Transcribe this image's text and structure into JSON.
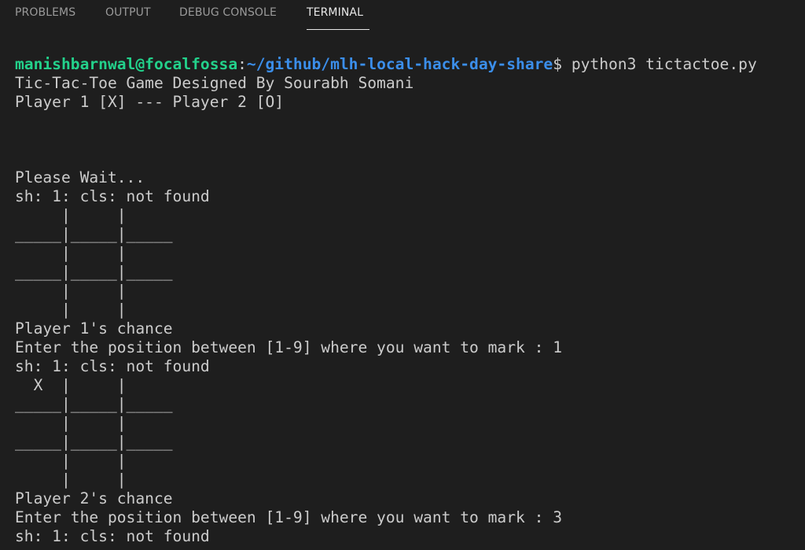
{
  "tabs": [
    {
      "label": "PROBLEMS",
      "active": false
    },
    {
      "label": "OUTPUT",
      "active": false
    },
    {
      "label": "DEBUG CONSOLE",
      "active": false
    },
    {
      "label": "TERMINAL",
      "active": true
    }
  ],
  "colors": {
    "background": "#1e1e1e",
    "text": "#cccccc",
    "prompt_user": "#23d18b",
    "prompt_path": "#3b8eea",
    "tab_inactive": "#9a9a9a",
    "tab_active": "#e7e7e7"
  },
  "prompt": {
    "user_host": "manishbarnwal@focalfossa",
    "separator": ":",
    "path": "~/github/mlh-local-hack-day-share",
    "symbol": "$ ",
    "command": "python3 tictactoe.py"
  },
  "output_lines": [
    "Tic-Tac-Toe Game Designed By Sourabh Somani",
    "Player 1 [X] --- Player 2 [O]",
    "",
    "",
    "",
    "Please Wait...",
    "sh: 1: cls: not found",
    "     |     |",
    "_____|_____|_____",
    "     |     |",
    "_____|_____|_____",
    "     |     |",
    "     |     |",
    "Player 1's chance",
    "Enter the position between [1-9] where you want to mark : 1",
    "sh: 1: cls: not found",
    "  X  |     |",
    "_____|_____|_____",
    "     |     |",
    "_____|_____|_____",
    "     |     |",
    "     |     |",
    "Player 2's chance",
    "Enter the position between [1-9] where you want to mark : 3",
    "sh: 1: cls: not found"
  ]
}
